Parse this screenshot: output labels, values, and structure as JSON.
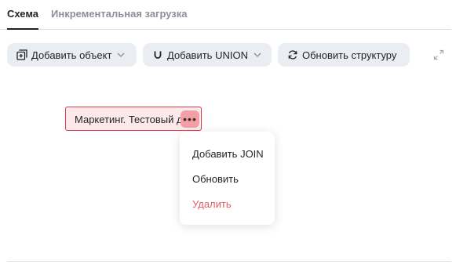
{
  "tabs": [
    {
      "label": "Схема",
      "active": true
    },
    {
      "label": "Инкрементальная загрузка",
      "active": false
    }
  ],
  "toolbar": {
    "add_object": {
      "label": "Добавить объект",
      "icon": "add-object-icon"
    },
    "add_union": {
      "label": "Добавить UNION",
      "icon": "union-icon"
    },
    "refresh": {
      "label": "Обновить структуру",
      "icon": "refresh-icon"
    },
    "expand_icon": "expand-icon"
  },
  "node": {
    "label": "Маркетинг. Тестовый д",
    "menu_label": "•••"
  },
  "context_menu": {
    "items": [
      {
        "label": "Добавить JOIN"
      },
      {
        "label": "Обновить"
      },
      {
        "label": "Удалить"
      }
    ]
  },
  "colors": {
    "accent_danger": "#e35d67",
    "node_border": "#d93c4a",
    "node_bg": "#fde8ea",
    "button_bg": "#eaedf2"
  }
}
